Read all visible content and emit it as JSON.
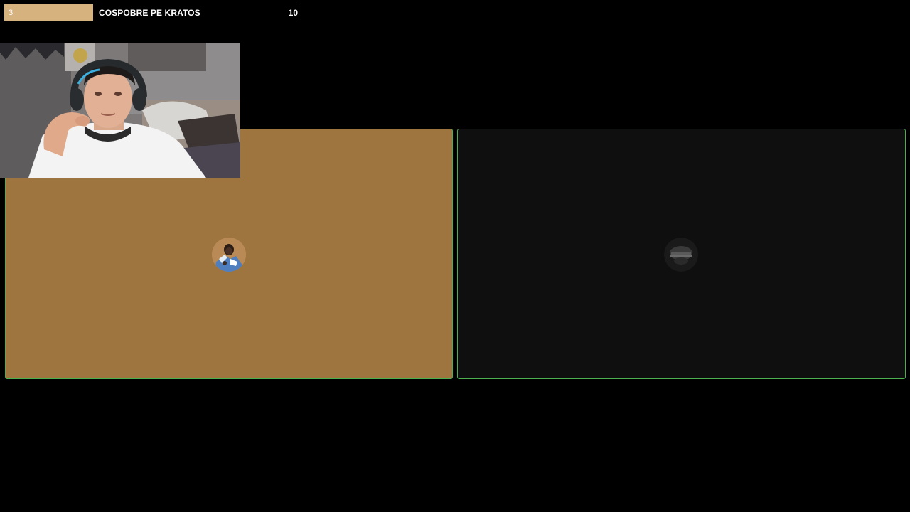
{
  "goal": {
    "current": "3",
    "title": "COSPOBRE PE KRATOS",
    "target": "10",
    "progress_fraction": 0.3,
    "fill_color": "#d6b27e"
  },
  "tiles": [
    {
      "name": "participant-1",
      "background": "#9e753e",
      "active_border": "#4caf50"
    },
    {
      "name": "participant-2",
      "background": "#0f0f0f",
      "active_border": "#4caf50"
    }
  ],
  "icons": {
    "avatar_1": "user-avatar-icon",
    "avatar_2": "user-avatar-icon"
  }
}
